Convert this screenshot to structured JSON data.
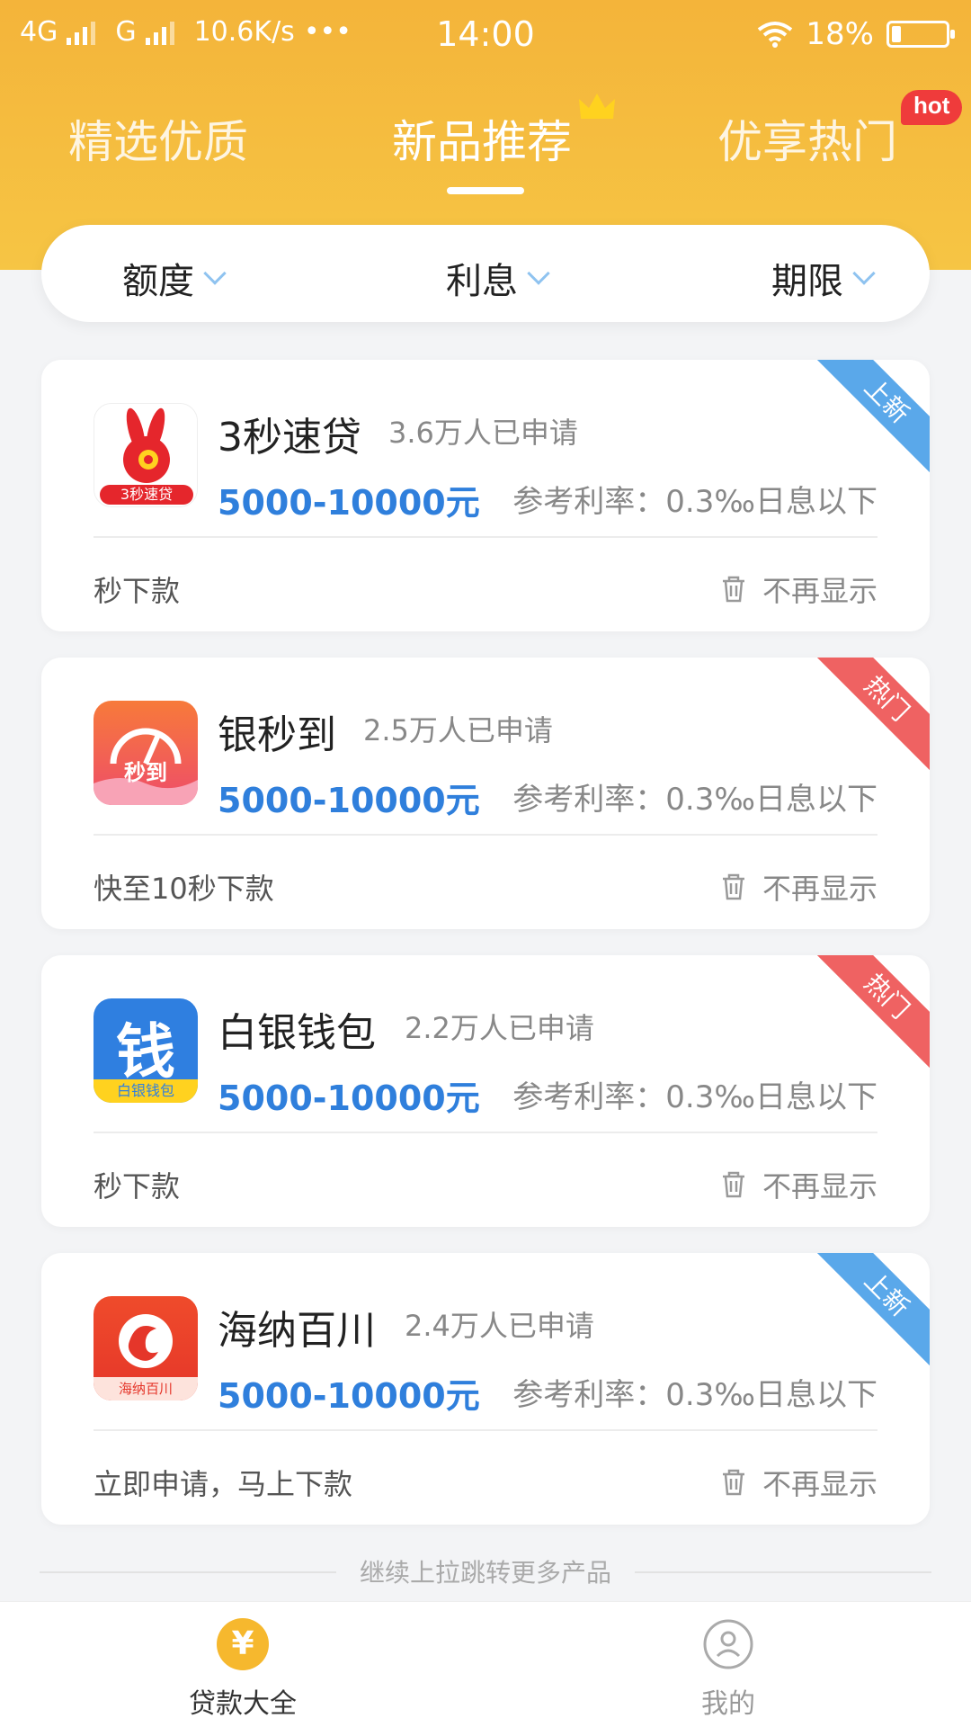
{
  "status_bar": {
    "network1": "4G",
    "network2": "G",
    "speed": "10.6K/s",
    "dots": "•••",
    "time": "14:00",
    "battery": "18%",
    "battery_level": 0.18
  },
  "tabs": [
    {
      "label": "精选优质"
    },
    {
      "label": "新品推荐"
    },
    {
      "label": "优享热门"
    }
  ],
  "hot_badge": "hot",
  "filters": [
    {
      "label": "额度"
    },
    {
      "label": "利息"
    },
    {
      "label": "期限"
    }
  ],
  "cards": [
    {
      "name": "3秒速贷",
      "applied": "3.6万人已申请",
      "amount": "5000-10000元",
      "rate": "参考利率：0.3‰日息以下",
      "note": "秒下款",
      "hide": "不再显示",
      "ribbon": "上新",
      "logo_text": "3秒速贷"
    },
    {
      "name": "银秒到",
      "applied": "2.5万人已申请",
      "amount": "5000-10000元",
      "rate": "参考利率：0.3‰日息以下",
      "note": "快至10秒下款",
      "hide": "不再显示",
      "ribbon": "热门",
      "logo_text": "秒到"
    },
    {
      "name": "白银钱包",
      "applied": "2.2万人已申请",
      "amount": "5000-10000元",
      "rate": "参考利率：0.3‰日息以下",
      "note": "秒下款",
      "hide": "不再显示",
      "ribbon": "热门",
      "logo_text": "白银钱包",
      "logo_char": "钱"
    },
    {
      "name": "海纳百川",
      "applied": "2.4万人已申请",
      "amount": "5000-10000元",
      "rate": "参考利率：0.3‰日息以下",
      "note": "立即申请，马上下款",
      "hide": "不再显示",
      "ribbon": "上新",
      "logo_text": "海纳百川"
    }
  ],
  "more_text": "继续上拉跳转更多产品",
  "bottom_nav": [
    {
      "label": "贷款大全",
      "icon": "yen-icon",
      "glyph": "¥"
    },
    {
      "label": "我的",
      "icon": "user-icon"
    }
  ],
  "colors": {
    "header": "#f4b43a",
    "amount": "#2f7fdc",
    "ribbon_new": "#5aa8ea",
    "ribbon_hot": "#ef6262",
    "active_nav": "#f6b82e"
  }
}
